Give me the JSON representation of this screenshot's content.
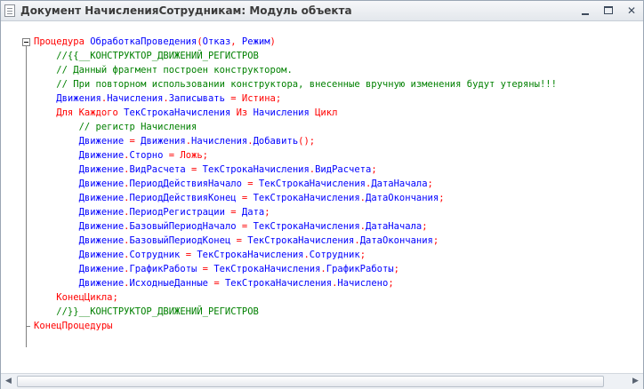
{
  "window": {
    "title": "Документ НачисленияСотрудникам: Модуль объекта",
    "minimize_icon": "minimize-icon",
    "maximize_icon": "maximize-icon",
    "close_icon": "close-icon",
    "close_glyph": "✕",
    "document_icon": "document-icon"
  },
  "colors": {
    "keyword": "#ff0000",
    "identifier": "#0000ff",
    "comment": "#008000"
  },
  "code": {
    "lines": [
      [
        {
          "t": "k",
          "s": "Процедура "
        },
        {
          "t": "i",
          "s": "ОбработкаПроведения"
        },
        {
          "t": "k",
          "s": "("
        },
        {
          "t": "i",
          "s": "Отказ"
        },
        {
          "t": "k",
          "s": ", "
        },
        {
          "t": "i",
          "s": "Режим"
        },
        {
          "t": "k",
          "s": ")"
        }
      ],
      [
        {
          "t": "c",
          "s": "    //{{__КОНСТРУКТОР_ДВИЖЕНИЙ_РЕГИСТРОВ"
        }
      ],
      [
        {
          "t": "c",
          "s": "    // Данный фрагмент построен конструктором."
        }
      ],
      [
        {
          "t": "c",
          "s": "    // При повторном использовании конструктора, внесенные вручную изменения будут утеряны!!!"
        }
      ],
      [
        {
          "t": "i",
          "s": "    Движения"
        },
        {
          "t": "k",
          "s": "."
        },
        {
          "t": "i",
          "s": "Начисления"
        },
        {
          "t": "k",
          "s": "."
        },
        {
          "t": "i",
          "s": "Записывать"
        },
        {
          "t": "k",
          "s": " = Истина;"
        }
      ],
      [
        {
          "t": "k",
          "s": "    Для Каждого "
        },
        {
          "t": "i",
          "s": "ТекСтрокаНачисления"
        },
        {
          "t": "k",
          "s": " Из "
        },
        {
          "t": "i",
          "s": "Начисления"
        },
        {
          "t": "k",
          "s": " Цикл"
        }
      ],
      [
        {
          "t": "c",
          "s": "        // регистр Начисления"
        }
      ],
      [
        {
          "t": "i",
          "s": "        Движение"
        },
        {
          "t": "k",
          "s": " = "
        },
        {
          "t": "i",
          "s": "Движения"
        },
        {
          "t": "k",
          "s": "."
        },
        {
          "t": "i",
          "s": "Начисления"
        },
        {
          "t": "k",
          "s": "."
        },
        {
          "t": "i",
          "s": "Добавить"
        },
        {
          "t": "k",
          "s": "();"
        }
      ],
      [
        {
          "t": "i",
          "s": "        Движение"
        },
        {
          "t": "k",
          "s": "."
        },
        {
          "t": "i",
          "s": "Сторно"
        },
        {
          "t": "k",
          "s": " = Ложь;"
        }
      ],
      [
        {
          "t": "i",
          "s": "        Движение"
        },
        {
          "t": "k",
          "s": "."
        },
        {
          "t": "i",
          "s": "ВидРасчета"
        },
        {
          "t": "k",
          "s": " = "
        },
        {
          "t": "i",
          "s": "ТекСтрокаНачисления"
        },
        {
          "t": "k",
          "s": "."
        },
        {
          "t": "i",
          "s": "ВидРасчета"
        },
        {
          "t": "k",
          "s": ";"
        }
      ],
      [
        {
          "t": "i",
          "s": "        Движение"
        },
        {
          "t": "k",
          "s": "."
        },
        {
          "t": "i",
          "s": "ПериодДействияНачало"
        },
        {
          "t": "k",
          "s": " = "
        },
        {
          "t": "i",
          "s": "ТекСтрокаНачисления"
        },
        {
          "t": "k",
          "s": "."
        },
        {
          "t": "i",
          "s": "ДатаНачала"
        },
        {
          "t": "k",
          "s": ";"
        }
      ],
      [
        {
          "t": "i",
          "s": "        Движение"
        },
        {
          "t": "k",
          "s": "."
        },
        {
          "t": "i",
          "s": "ПериодДействияКонец"
        },
        {
          "t": "k",
          "s": " = "
        },
        {
          "t": "i",
          "s": "ТекСтрокаНачисления"
        },
        {
          "t": "k",
          "s": "."
        },
        {
          "t": "i",
          "s": "ДатаОкончания"
        },
        {
          "t": "k",
          "s": ";"
        }
      ],
      [
        {
          "t": "i",
          "s": "        Движение"
        },
        {
          "t": "k",
          "s": "."
        },
        {
          "t": "i",
          "s": "ПериодРегистрации"
        },
        {
          "t": "k",
          "s": " = "
        },
        {
          "t": "i",
          "s": "Дата"
        },
        {
          "t": "k",
          "s": ";"
        }
      ],
      [
        {
          "t": "i",
          "s": "        Движение"
        },
        {
          "t": "k",
          "s": "."
        },
        {
          "t": "i",
          "s": "БазовыйПериодНачало"
        },
        {
          "t": "k",
          "s": " = "
        },
        {
          "t": "i",
          "s": "ТекСтрокаНачисления"
        },
        {
          "t": "k",
          "s": "."
        },
        {
          "t": "i",
          "s": "ДатаНачала"
        },
        {
          "t": "k",
          "s": ";"
        }
      ],
      [
        {
          "t": "i",
          "s": "        Движение"
        },
        {
          "t": "k",
          "s": "."
        },
        {
          "t": "i",
          "s": "БазовыйПериодКонец"
        },
        {
          "t": "k",
          "s": " = "
        },
        {
          "t": "i",
          "s": "ТекСтрокаНачисления"
        },
        {
          "t": "k",
          "s": "."
        },
        {
          "t": "i",
          "s": "ДатаОкончания"
        },
        {
          "t": "k",
          "s": ";"
        }
      ],
      [
        {
          "t": "i",
          "s": "        Движение"
        },
        {
          "t": "k",
          "s": "."
        },
        {
          "t": "i",
          "s": "Сотрудник"
        },
        {
          "t": "k",
          "s": " = "
        },
        {
          "t": "i",
          "s": "ТекСтрокаНачисления"
        },
        {
          "t": "k",
          "s": "."
        },
        {
          "t": "i",
          "s": "Сотрудник"
        },
        {
          "t": "k",
          "s": ";"
        }
      ],
      [
        {
          "t": "i",
          "s": "        Движение"
        },
        {
          "t": "k",
          "s": "."
        },
        {
          "t": "i",
          "s": "ГрафикРаботы"
        },
        {
          "t": "k",
          "s": " = "
        },
        {
          "t": "i",
          "s": "ТекСтрокаНачисления"
        },
        {
          "t": "k",
          "s": "."
        },
        {
          "t": "i",
          "s": "ГрафикРаботы"
        },
        {
          "t": "k",
          "s": ";"
        }
      ],
      [
        {
          "t": "i",
          "s": "        Движение"
        },
        {
          "t": "k",
          "s": "."
        },
        {
          "t": "i",
          "s": "ИсходныеДанные"
        },
        {
          "t": "k",
          "s": " = "
        },
        {
          "t": "i",
          "s": "ТекСтрокаНачисления"
        },
        {
          "t": "k",
          "s": "."
        },
        {
          "t": "i",
          "s": "Начислено"
        },
        {
          "t": "k",
          "s": ";"
        }
      ],
      [
        {
          "t": "k",
          "s": "    КонецЦикла;"
        }
      ],
      [
        {
          "t": "c",
          "s": "    //}}__КОНСТРУКТОР_ДВИЖЕНИЙ_РЕГИСТРОВ"
        }
      ],
      [
        {
          "t": "k",
          "s": "КонецПроцедуры"
        }
      ]
    ]
  },
  "scrollbar": {
    "left_arrow_icon": "scroll-left-icon",
    "right_arrow_icon": "scroll-right-icon",
    "left_glyph": "◀",
    "right_glyph": "▶"
  }
}
